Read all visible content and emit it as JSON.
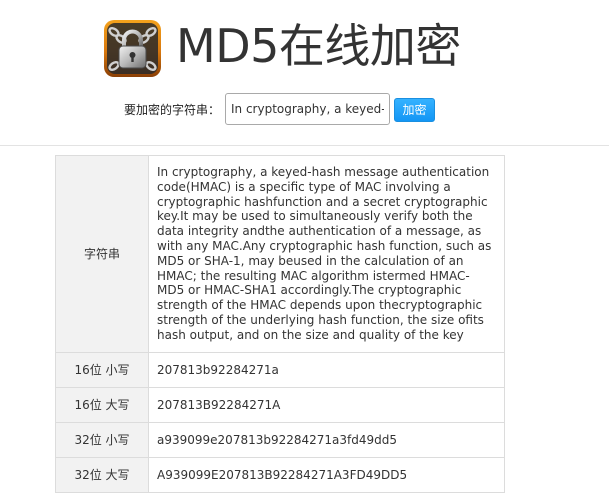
{
  "header": {
    "title": "MD5在线加密",
    "logo_icon": "padlock-chains-icon"
  },
  "form": {
    "label": "要加密的字符串：",
    "input_value": "In cryptography, a keyed-hash message authentication code(HMAC) is a specific type of MAC involving a cryptographic hashfunction and a secret cryptographic key.It may be used to simultaneously verify both the data integrity andthe authentication of a message, as with any MAC.Any cryptographic hash function, such as MD5 or SHA-1, may beused in the calculation of an HMAC; the resulting MAC algorithm istermed HMAC-MD5 or HMAC-SHA1 accordingly.The cryptographic strength of the HMAC depends upon thecryptographic strength of the underlying hash function, the size ofits hash output, and on the size and quality of the key",
    "button_label": "加密",
    "button_color": "#1e9fff"
  },
  "result": {
    "rows": [
      {
        "label": "字符串",
        "value": "In cryptography, a keyed-hash message authentication code(HMAC) is a specific type of MAC involving a cryptographic hashfunction and a secret cryptographic key.It may be used to simultaneously verify both the data integrity andthe authentication of a message, as with any MAC.Any cryptographic hash function, such as MD5 or SHA-1, may beused in the calculation of an HMAC; the resulting MAC algorithm istermed HMAC-MD5 or HMAC-SHA1 accordingly.The cryptographic strength of the HMAC depends upon thecryptographic strength of the underlying hash function, the size ofits hash output, and on the size and quality of the key"
      },
      {
        "label": "16位 小写",
        "value": "207813b92284271a"
      },
      {
        "label": "16位 大写",
        "value": "207813B92284271A"
      },
      {
        "label": "32位 小写",
        "value": "a939099e207813b92284271a3fd49dd5"
      },
      {
        "label": "32位 大写",
        "value": "A939099E207813B92284271A3FD49DD5"
      }
    ]
  }
}
